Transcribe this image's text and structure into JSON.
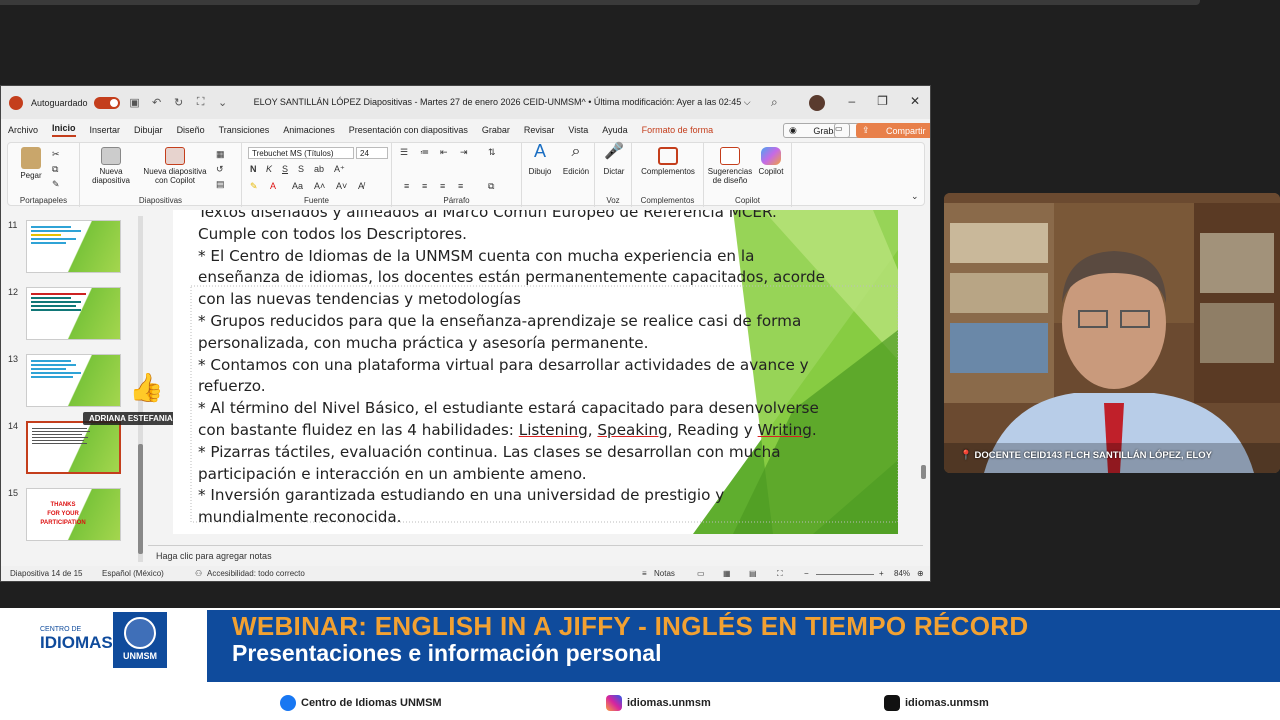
{
  "window": {
    "autosave_label": "Autoguardado",
    "doc_title": "ELOY SANTILLÁN LÓPEZ Diapositivas - Martes 27 de enero 2026 CEID-UNMSM^ • Última modificación: Ayer a las 02:45 ⌵"
  },
  "menu": {
    "items": [
      "Archivo",
      "Inicio",
      "Insertar",
      "Dibujar",
      "Diseño",
      "Transiciones",
      "Animaciones",
      "Presentación con diapositivas",
      "Grabar",
      "Revisar",
      "Vista",
      "Ayuda",
      "Formato de forma"
    ],
    "grabar": "Grabar",
    "compartir": "Compartir"
  },
  "ribbon": {
    "pegar": "Pegar",
    "nueva_diapositiva": "Nueva diapositiva",
    "nueva_copilot": "Nueva diapositiva con Copilot",
    "font_name": "Trebuchet MS (Títulos)",
    "font_size": "24",
    "dibujo": "Dibujo",
    "edicion": "Edición",
    "dictar": "Dictar",
    "complementos": "Complementos",
    "sugerencias": "Sugerencias de diseño",
    "copilot": "Copilot",
    "groups": {
      "portapapeles": "Portapapeles",
      "diapositivas": "Diapositivas",
      "fuente": "Fuente",
      "parrafo": "Párrafo",
      "voz": "Voz",
      "complementos": "Complementos",
      "copilot": "Copilot"
    }
  },
  "thumbnails": [
    {
      "num": "11"
    },
    {
      "num": "12"
    },
    {
      "num": "13"
    },
    {
      "num": "14"
    },
    {
      "num": "15",
      "text": "THANKS\nFOR YOUR PARTICIPATION"
    }
  ],
  "participant_tag": "ADRIANA ESTEFANIA RA...",
  "slide": {
    "lines": [
      "Textos diseñados y alineados al Marco Común Europeo de Referencia MCER.",
      "Cumple con todos los Descriptores.",
      "* El Centro de Idiomas de la UNMSM cuenta con mucha experiencia en la",
      "enseñanza de idiomas, los docentes están permanentemente capacitados, acorde",
      "con las nuevas tendencias y metodologías",
      "* Grupos reducidos para que la enseñanza-aprendizaje se realice casi de forma",
      "personalizada, con mucha práctica y asesoría permanente.",
      "* Contamos con una plataforma virtual para desarrollar actividades de avance y",
      "refuerzo.",
      "* Al término del Nivel Básico, el estudiante estará capacitado para desenvolverse",
      "* Pizarras táctiles, evaluación continua. Las clases se desarrollan con mucha",
      "participación e interacción en un ambiente ameno.",
      "* Inversión garantizada estudiando en una universidad de prestigio y",
      "mundialmente reconocida."
    ],
    "skills_prefix": "con bastante fluidez en las 4 habilidades: ",
    "skills": [
      "Listening",
      "Speaking",
      "Reading",
      "Writing"
    ]
  },
  "notes_placeholder": "Haga clic para agregar notas",
  "status": {
    "slide_count": "Diapositiva 14 de 15",
    "language": "Español (México)",
    "accessibility": "Accesibilidad: todo correcto",
    "notes": "Notas",
    "zoom": "84%"
  },
  "camera": {
    "label": "DOCENTE CEID143 FLCH SANTILLÁN LÓPEZ, ELOY"
  },
  "banner": {
    "title": "WEBINAR: ENGLISH IN A JIFFY - INGLÉS EN TIEMPO RÉCORD",
    "subtitle": "Presentaciones e información personal",
    "logo_small": "CENTRO DE",
    "logo_big": "IDIOMAS",
    "seal_text": "UNMSM",
    "socials": [
      "Centro de Idiomas UNMSM",
      "idiomas.unmsm",
      "idiomas.unmsm"
    ]
  },
  "colors": {
    "accent": "#c43e1c",
    "banner_blue": "#0f4b9c",
    "banner_orange": "#f2a132",
    "slide_green": "#7ac43a"
  }
}
